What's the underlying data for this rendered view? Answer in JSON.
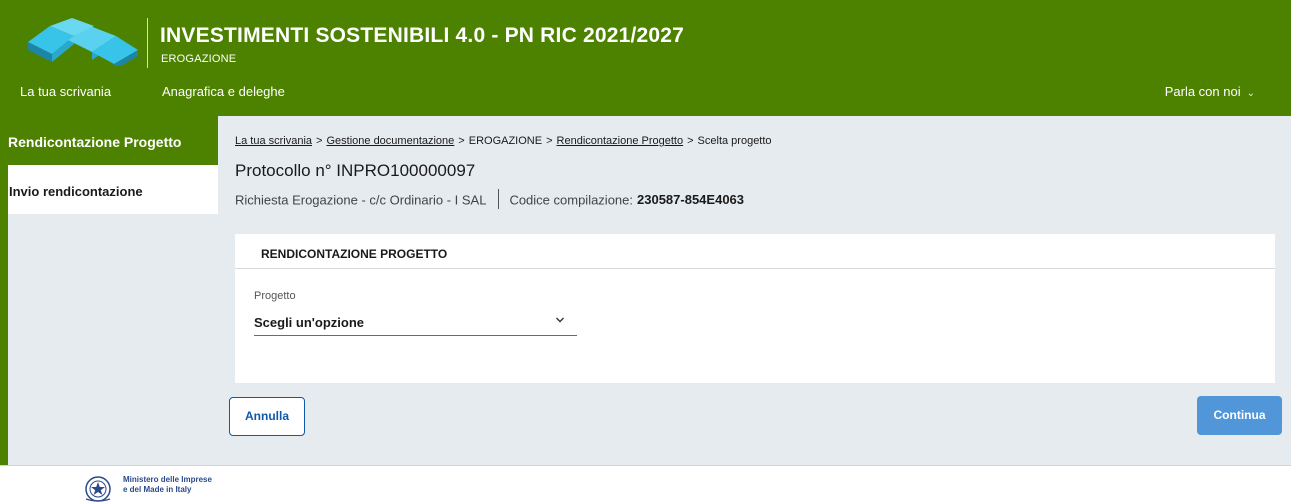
{
  "header": {
    "app_title": "INVESTIMENTI SOSTENIBILI 4.0 - PN RIC 2021/2027",
    "app_subtitle": "EROGAZIONE",
    "nav": [
      {
        "label": "La tua scrivania"
      },
      {
        "label": "Anagrafica e deleghe"
      }
    ],
    "contact_label": "Parla con noi",
    "logo_icon": "infinity-logo-icon"
  },
  "sidebar": {
    "active_label": "Rendicontazione Progetto",
    "items": [
      {
        "label": "Invio rendicontazione"
      }
    ]
  },
  "breadcrumb": {
    "items": [
      {
        "label": "La tua scrivania",
        "link": true
      },
      {
        "label": "Gestione documentazione",
        "link": true
      },
      {
        "label": "EROGAZIONE",
        "link": false
      },
      {
        "label": "Rendicontazione Progetto",
        "link": true
      },
      {
        "label": "Scelta progetto",
        "link": false
      }
    ],
    "separator": ">"
  },
  "main": {
    "protocol": "Protocollo n° INPRO100000097",
    "request_info": "Richiesta Erogazione - c/c Ordinario  -  I SAL",
    "code_label": "Codice compilazione:",
    "code_value": "230587-854E4063"
  },
  "card": {
    "title": "RENDICONTAZIONE PROGETTO",
    "field_label": "Progetto",
    "select_value": "Scegli un'opzione"
  },
  "actions": {
    "cancel_label": "Annulla",
    "continue_label": "Continua"
  },
  "footer": {
    "ministry_line1": "Ministero delle Imprese",
    "ministry_line2": "e del Made in Italy",
    "emblem_icon": "italian-republic-emblem-icon"
  },
  "colors": {
    "header_green": "#4d8200",
    "page_bg": "#e6ebf0",
    "primary_blue": "#0f5aa8",
    "continue_blue": "#5196d8"
  }
}
